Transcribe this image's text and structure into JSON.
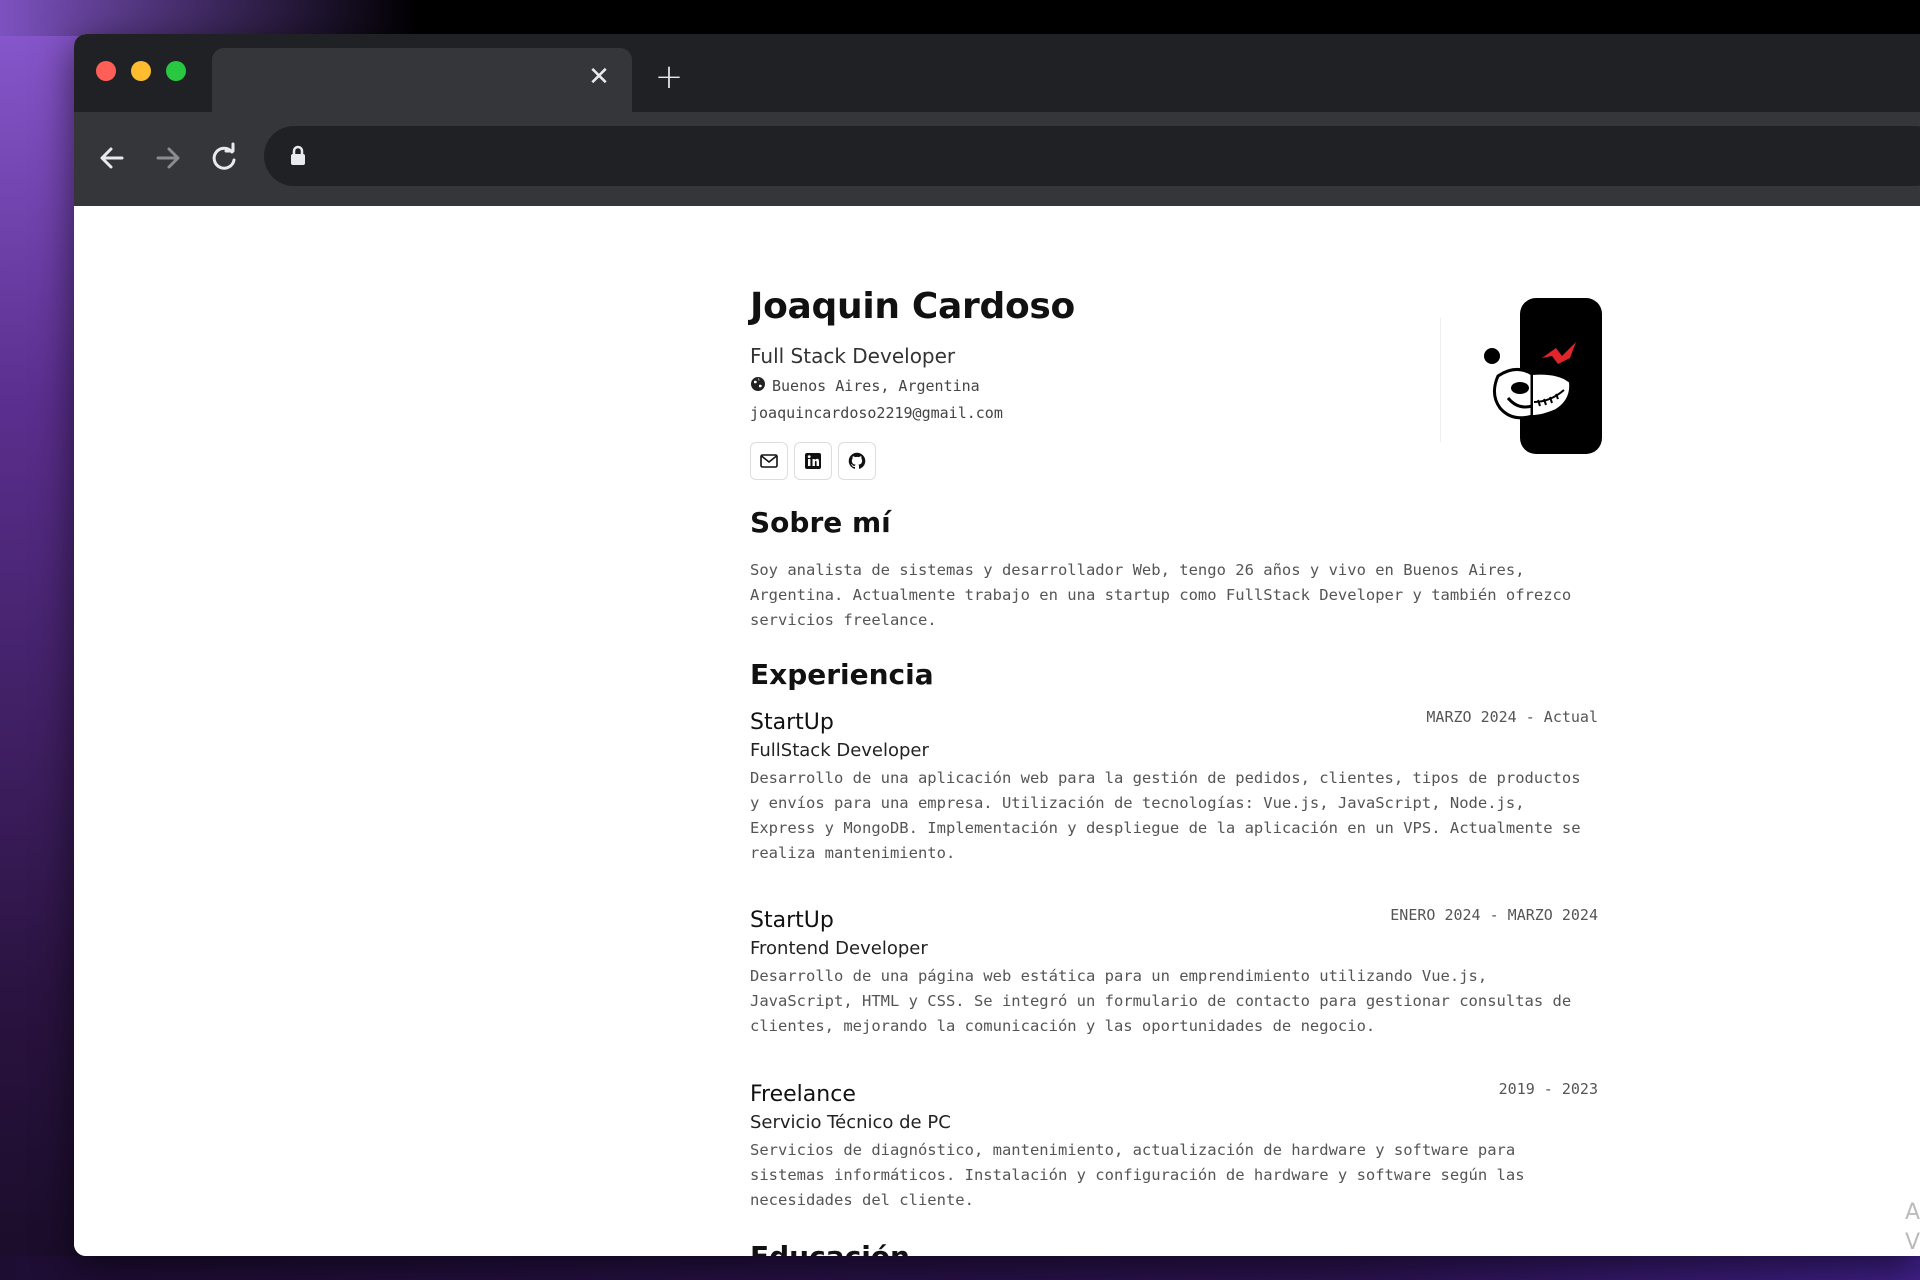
{
  "browser": {
    "tab_close_glyph": "✕",
    "new_tab_glyph": "+",
    "icons": [
      "back-icon",
      "forward-icon",
      "reload-icon",
      "lock-icon"
    ]
  },
  "profile": {
    "name": "Joaquin Cardoso",
    "role": "Full Stack Developer",
    "location": "Buenos Aires, Argentina",
    "email": "joaquincardoso2219@gmail.com",
    "social_icons": [
      "mail-icon",
      "linkedin-icon",
      "github-icon"
    ]
  },
  "about": {
    "heading": "Sobre mí",
    "text": "Soy analista de sistemas y desarrollador Web, tengo 26 años y vivo en Buenos Aires, Argentina. Actualmente trabajo en una startup como FullStack Developer y también ofrezco servicios freelance."
  },
  "experience": {
    "heading": "Experiencia",
    "jobs": [
      {
        "company": "StartUp",
        "dates": "MARZO 2024 - Actual",
        "title": "FullStack Developer",
        "description": "Desarrollo de una aplicación web para la gestión de pedidos, clientes, tipos de productos y envíos para una empresa. Utilización de tecnologías: Vue.js, JavaScript, Node.js, Express y MongoDB. Implementación y despliegue de la aplicación en un VPS. Actualmente se realiza mantenimiento."
      },
      {
        "company": "StartUp",
        "dates": "ENERO 2024 - MARZO 2024",
        "title": "Frontend Developer",
        "description": "Desarrollo de una página web estática para un emprendimiento utilizando Vue.js, JavaScript, HTML y CSS. Se integró un formulario de contacto para gestionar consultas de clientes, mejorando la comunicación y las oportunidades de negocio."
      },
      {
        "company": "Freelance",
        "dates": "2019 - 2023",
        "title": "Servicio Técnico de PC",
        "description": "Servicios de diagnóstico, mantenimiento, actualización de hardware y software para sistemas informáticos. Instalación y configuración de hardware y software según las necesidades del cliente."
      }
    ]
  },
  "education": {
    "heading": "Educación"
  },
  "watermark": {
    "line1": "A",
    "line2": "V"
  },
  "colors": {
    "window_titlebar": "#1f2124",
    "toolbar": "#35363a",
    "text_dark": "#111111",
    "text_muted": "#555555",
    "avatar_red": "#e0262b"
  }
}
